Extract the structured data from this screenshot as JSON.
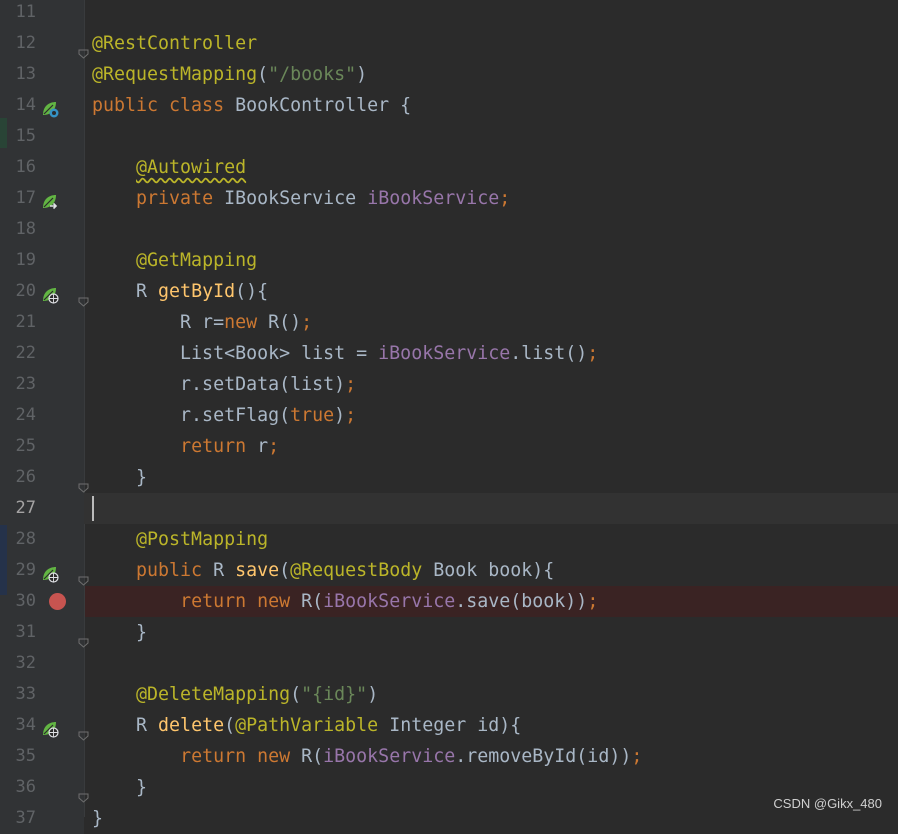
{
  "editor": {
    "lines": [
      {
        "n": "11",
        "segs": []
      },
      {
        "n": "12",
        "fold": true,
        "segs": [
          [
            "ann",
            "@RestController"
          ]
        ]
      },
      {
        "n": "13",
        "segs": [
          [
            "ann",
            "@RequestMapping"
          ],
          [
            "pl",
            "("
          ],
          [
            "str",
            "\"/books\""
          ],
          [
            "pl",
            ")"
          ]
        ]
      },
      {
        "n": "14",
        "icon": "spring-bean-icon",
        "segs": [
          [
            "kw",
            "public class "
          ],
          [
            "pl",
            "BookController {"
          ]
        ]
      },
      {
        "n": "15",
        "segs": []
      },
      {
        "n": "16",
        "segs": [
          [
            "pl",
            "    "
          ],
          [
            "ann warn",
            "@Autowired"
          ]
        ]
      },
      {
        "n": "17",
        "icon": "autowired-navigate-icon",
        "segs": [
          [
            "pl",
            "    "
          ],
          [
            "kw",
            "private "
          ],
          [
            "pl",
            "IBookService "
          ],
          [
            "fld",
            "iBookService"
          ],
          [
            "kw",
            ";"
          ]
        ]
      },
      {
        "n": "18",
        "segs": []
      },
      {
        "n": "19",
        "segs": [
          [
            "pl",
            "    "
          ],
          [
            "ann",
            "@GetMapping"
          ]
        ]
      },
      {
        "n": "20",
        "icon": "web-endpoint-icon",
        "fold": true,
        "segs": [
          [
            "pl",
            "    R "
          ],
          [
            "fn",
            "getById"
          ],
          [
            "pl",
            "(){"
          ]
        ]
      },
      {
        "n": "21",
        "segs": [
          [
            "pl",
            "        R r="
          ],
          [
            "kw",
            "new "
          ],
          [
            "pl",
            "R()"
          ],
          [
            "kw",
            ";"
          ]
        ]
      },
      {
        "n": "22",
        "segs": [
          [
            "pl",
            "        List<Book> list = "
          ],
          [
            "fld",
            "iBookService"
          ],
          [
            "pl",
            ".list()"
          ],
          [
            "kw",
            ";"
          ]
        ]
      },
      {
        "n": "23",
        "segs": [
          [
            "pl",
            "        r.setData(list)"
          ],
          [
            "kw",
            ";"
          ]
        ]
      },
      {
        "n": "24",
        "segs": [
          [
            "pl",
            "        r.setFlag("
          ],
          [
            "kw",
            "true"
          ],
          [
            "pl",
            ")"
          ],
          [
            "kw",
            ";"
          ]
        ]
      },
      {
        "n": "25",
        "segs": [
          [
            "pl",
            "        "
          ],
          [
            "kw",
            "return "
          ],
          [
            "pl",
            "r"
          ],
          [
            "kw",
            ";"
          ]
        ]
      },
      {
        "n": "26",
        "fold": true,
        "segs": [
          [
            "pl",
            "    }"
          ]
        ]
      },
      {
        "n": "27",
        "current": true,
        "segs": []
      },
      {
        "n": "28",
        "segs": [
          [
            "pl",
            "    "
          ],
          [
            "ann",
            "@PostMapping"
          ]
        ]
      },
      {
        "n": "29",
        "icon": "web-endpoint-icon",
        "fold": true,
        "segs": [
          [
            "pl",
            "    "
          ],
          [
            "kw",
            "public "
          ],
          [
            "pl",
            "R "
          ],
          [
            "fn",
            "save"
          ],
          [
            "pl",
            "("
          ],
          [
            "ann",
            "@RequestBody "
          ],
          [
            "pl",
            "Book book){"
          ]
        ]
      },
      {
        "n": "30",
        "breakpoint": true,
        "segs": [
          [
            "pl",
            "        "
          ],
          [
            "kw",
            "return new "
          ],
          [
            "pl",
            "R("
          ],
          [
            "fld",
            "iBookService"
          ],
          [
            "pl",
            ".save(book))"
          ],
          [
            "kw",
            ";"
          ]
        ]
      },
      {
        "n": "31",
        "fold": true,
        "segs": [
          [
            "pl",
            "    }"
          ]
        ]
      },
      {
        "n": "32",
        "segs": []
      },
      {
        "n": "33",
        "segs": [
          [
            "pl",
            "    "
          ],
          [
            "ann",
            "@DeleteMapping"
          ],
          [
            "pl",
            "("
          ],
          [
            "str",
            "\"{id}\""
          ],
          [
            "pl",
            ")"
          ]
        ]
      },
      {
        "n": "34",
        "icon": "web-endpoint-icon",
        "fold": true,
        "segs": [
          [
            "pl",
            "    R "
          ],
          [
            "fn",
            "delete"
          ],
          [
            "pl",
            "("
          ],
          [
            "ann",
            "@PathVariable "
          ],
          [
            "pl",
            "Integer id){"
          ]
        ]
      },
      {
        "n": "35",
        "segs": [
          [
            "pl",
            "        "
          ],
          [
            "kw",
            "return new "
          ],
          [
            "pl",
            "R("
          ],
          [
            "fld",
            "iBookService"
          ],
          [
            "pl",
            ".removeById(id))"
          ],
          [
            "kw",
            ";"
          ]
        ]
      },
      {
        "n": "36",
        "fold": true,
        "segs": [
          [
            "pl",
            "    }"
          ]
        ]
      },
      {
        "n": "37",
        "segs": [
          [
            "pl",
            "}"
          ]
        ]
      }
    ]
  },
  "watermark": "CSDN @Gikx_480",
  "colors": {
    "background": "#2b2b2b",
    "gutter": "#313335",
    "annotation": "#bbb529",
    "keyword": "#cc7832",
    "string": "#6a8759",
    "method": "#ffc66d",
    "field": "#9876aa",
    "plain": "#a9b7c6",
    "breakpoint": "#c75450"
  }
}
